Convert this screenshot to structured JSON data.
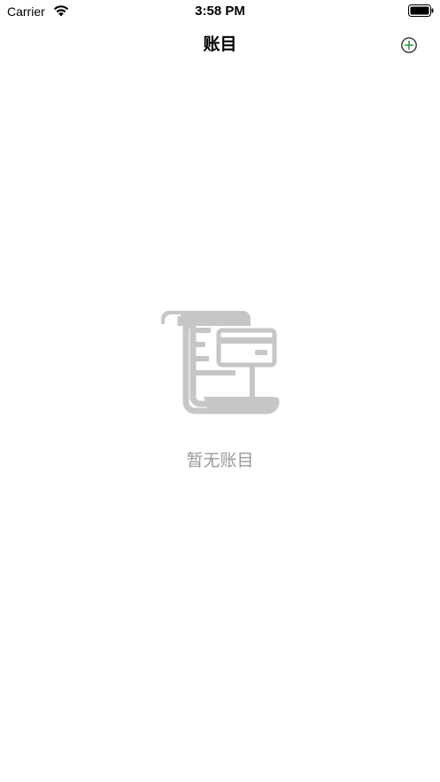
{
  "status_bar": {
    "carrier": "Carrier",
    "time": "3:58 PM",
    "wifi_icon": "wifi-icon",
    "battery_icon": "battery-icon"
  },
  "nav": {
    "title": "账目",
    "add_icon": "plus-circle-icon"
  },
  "empty_state": {
    "icon": "receipt-card-icon",
    "message": "暂无账目"
  },
  "colors": {
    "accent": "#2a9a3e",
    "placeholder_gray": "#9a9a9a",
    "icon_gray": "#c6c6c6"
  }
}
